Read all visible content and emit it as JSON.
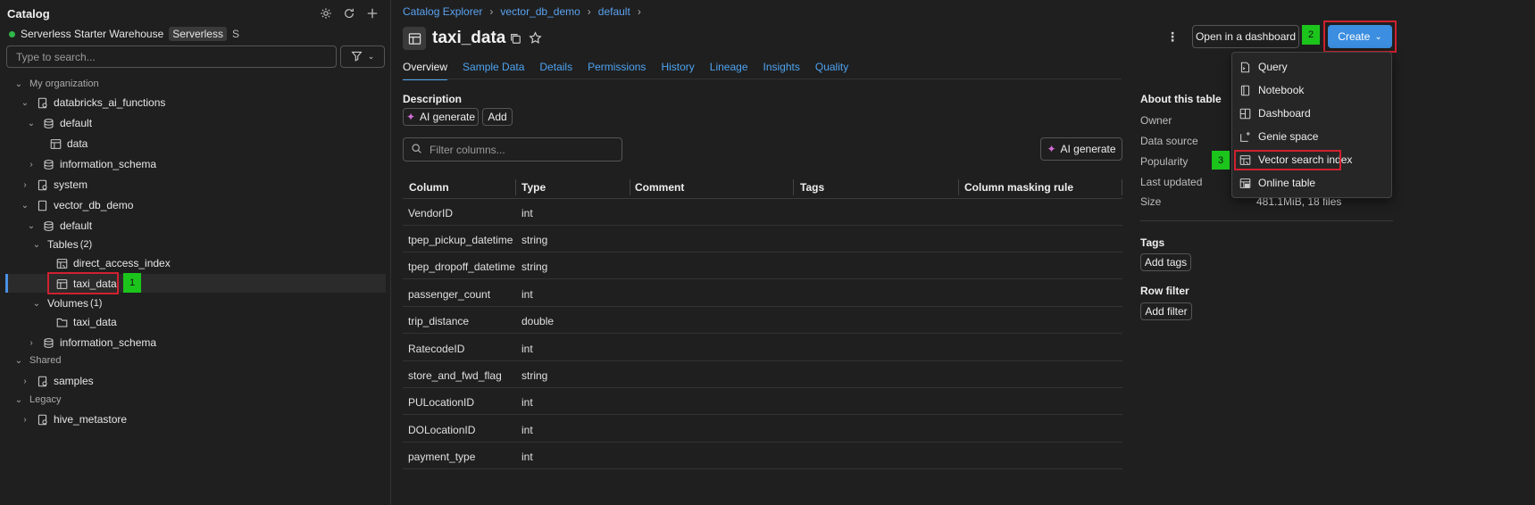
{
  "sidebar": {
    "title": "Catalog",
    "warehouse": {
      "name": "Serverless Starter Warehouse",
      "badge": "Serverless",
      "size": "S"
    },
    "search_placeholder": "Type to search...",
    "tree": [
      {
        "label": "My organization",
        "kind": "section"
      },
      {
        "label": "databricks_ai_functions",
        "kind": "catalog"
      },
      {
        "label": "default",
        "kind": "schema"
      },
      {
        "label": "data",
        "kind": "table"
      },
      {
        "label": "information_schema",
        "kind": "schema"
      },
      {
        "label": "system",
        "kind": "catalog"
      },
      {
        "label": "vector_db_demo",
        "kind": "catalog"
      },
      {
        "label": "default",
        "kind": "schema"
      },
      {
        "label": "Tables",
        "count": "(2)",
        "kind": "group"
      },
      {
        "label": "direct_access_index",
        "kind": "index"
      },
      {
        "label": "taxi_data",
        "kind": "table",
        "selected": true
      },
      {
        "label": "Volumes",
        "count": "(1)",
        "kind": "group"
      },
      {
        "label": "taxi_data",
        "kind": "volume"
      },
      {
        "label": "information_schema",
        "kind": "schema"
      },
      {
        "label": "Shared",
        "kind": "section"
      },
      {
        "label": "samples",
        "kind": "catalog"
      },
      {
        "label": "Legacy",
        "kind": "section"
      },
      {
        "label": "hive_metastore",
        "kind": "catalog"
      }
    ]
  },
  "breadcrumb": [
    "Catalog Explorer",
    "vector_db_demo",
    "default"
  ],
  "page_title": "taxi_data",
  "tabs": [
    "Overview",
    "Sample Data",
    "Details",
    "Permissions",
    "History",
    "Lineage",
    "Insights",
    "Quality"
  ],
  "active_tab": "Overview",
  "buttons": {
    "open_dashboard": "Open in a dashboard",
    "create": "Create",
    "ai_generate": "AI generate",
    "add": "Add",
    "add_tags": "Add tags",
    "add_filter": "Add filter"
  },
  "description_label": "Description",
  "filter_columns_placeholder": "Filter columns...",
  "columns_table": {
    "headers": [
      "Column",
      "Type",
      "Comment",
      "Tags",
      "Column masking rule"
    ],
    "rows": [
      [
        "VendorID",
        "int"
      ],
      [
        "tpep_pickup_datetime",
        "string"
      ],
      [
        "tpep_dropoff_datetime",
        "string"
      ],
      [
        "passenger_count",
        "int"
      ],
      [
        "trip_distance",
        "double"
      ],
      [
        "RatecodeID",
        "int"
      ],
      [
        "store_and_fwd_flag",
        "string"
      ],
      [
        "PULocationID",
        "int"
      ],
      [
        "DOLocationID",
        "int"
      ],
      [
        "payment_type",
        "int"
      ]
    ]
  },
  "about": {
    "title": "About this table",
    "labels": [
      "Owner",
      "Data source",
      "Popularity",
      "Last updated",
      "Size"
    ],
    "size_value": "481.1MiB, 18 files"
  },
  "tags_label": "Tags",
  "row_filter_label": "Row filter",
  "create_menu": [
    {
      "label": "Query",
      "icon": "query-icon"
    },
    {
      "label": "Notebook",
      "icon": "notebook-icon"
    },
    {
      "label": "Dashboard",
      "icon": "dashboard-icon"
    },
    {
      "label": "Genie space",
      "icon": "genie-icon"
    },
    {
      "label": "Vector search index",
      "icon": "vector-index-icon"
    },
    {
      "label": "Online table",
      "icon": "online-table-icon"
    }
  ],
  "annotations": [
    "1",
    "2",
    "3"
  ],
  "colors": {
    "accent": "#4ea3f0",
    "primary_button": "#3b8ee0",
    "highlight": "#d0212f",
    "marker": "#1cc51c",
    "status": "#2fb84a"
  }
}
